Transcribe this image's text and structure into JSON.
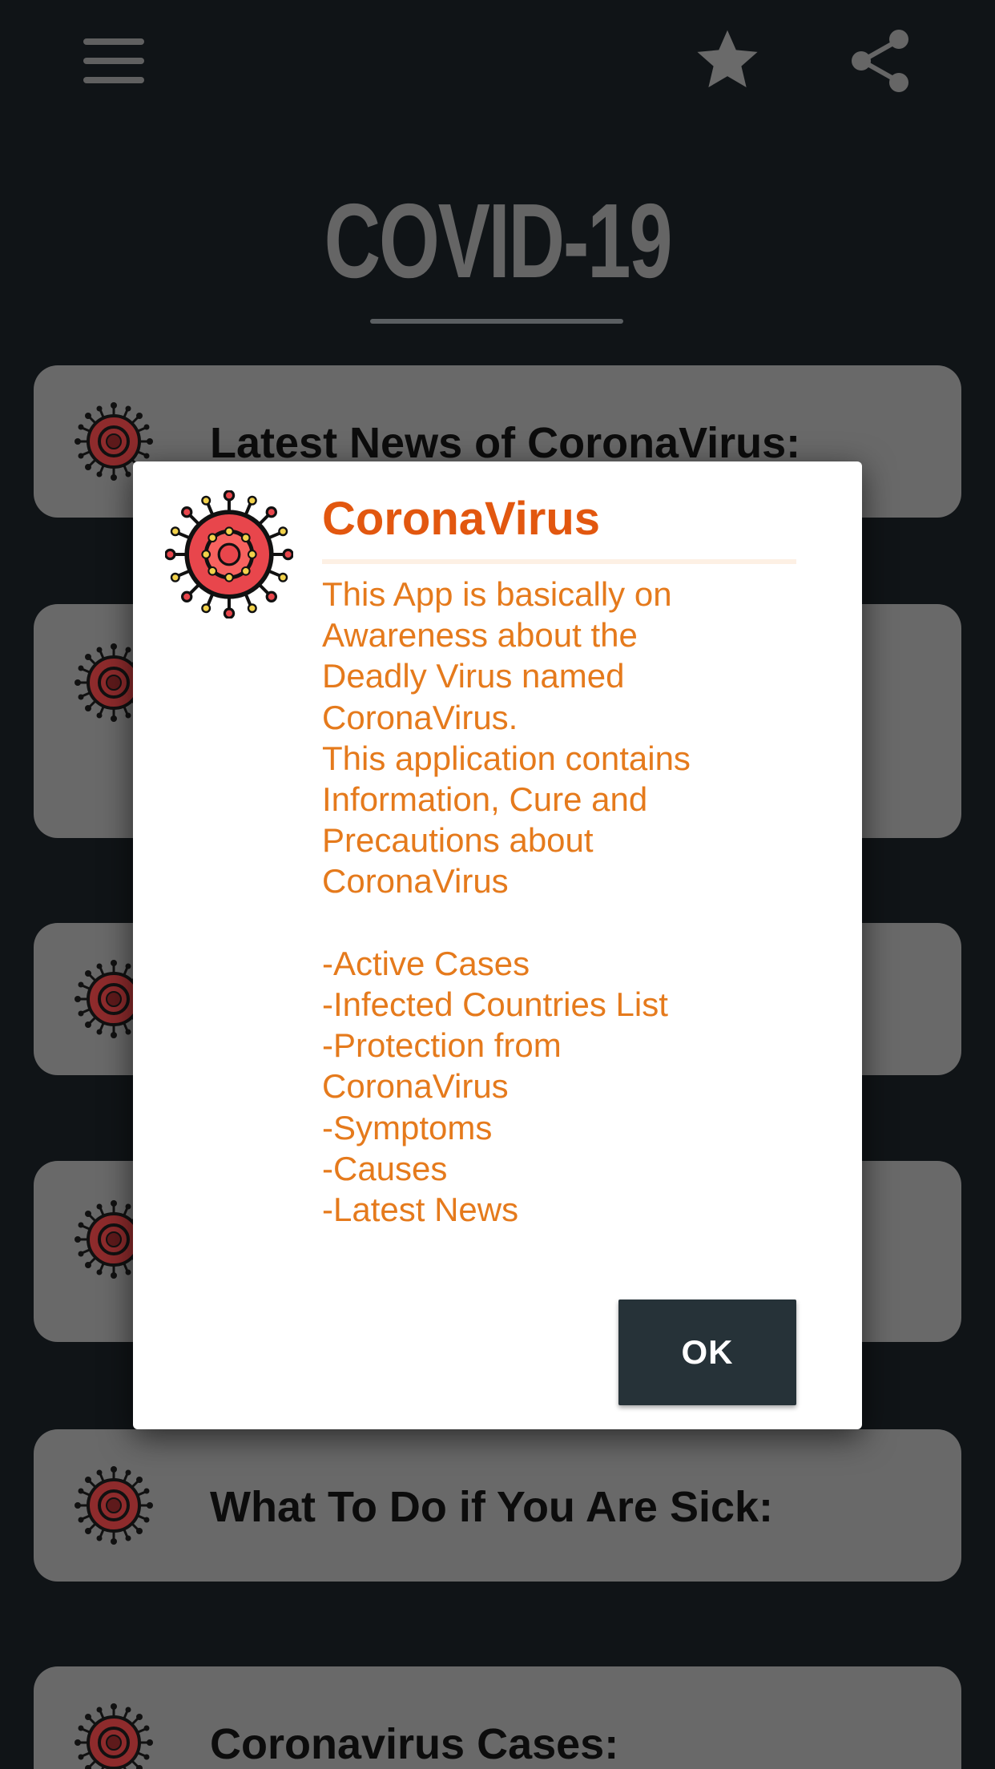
{
  "topbar": {
    "menu_icon": "menu-icon",
    "favorite_icon": "star-icon",
    "share_icon": "share-icon"
  },
  "header": {
    "title": "COVID-19"
  },
  "list": {
    "items": [
      {
        "label": "Latest News of CoronaVirus:",
        "icon": "virus-icon"
      },
      {
        "label": "",
        "icon": "virus-icon"
      },
      {
        "label": "",
        "icon": "virus-icon"
      },
      {
        "label": "",
        "icon": "virus-icon"
      },
      {
        "label": "What To Do if You Are Sick:",
        "icon": "virus-icon"
      },
      {
        "label": "Coronavirus Cases:",
        "icon": "virus-icon"
      }
    ]
  },
  "dialog": {
    "icon": "virus-icon",
    "title": "CoronaVirus",
    "body_lines": [
      "This App is basically on",
      "Awareness about the",
      "Deadly Virus named",
      "CoronaVirus.",
      "This application contains",
      "Information, Cure and",
      "Precautions about",
      "CoronaVirus",
      "",
      "-Active Cases",
      "-Infected Countries List",
      "-Protection from",
      "CoronaVirus",
      "-Symptoms",
      "-Causes",
      "-Latest News"
    ],
    "ok_label": "OK"
  },
  "colors": {
    "background": "#101417",
    "card": "#696969",
    "dialog_title": "#e2570f",
    "dialog_text": "#e57a1c",
    "ok_button": "#263238",
    "virus_red": "#e8464c"
  }
}
